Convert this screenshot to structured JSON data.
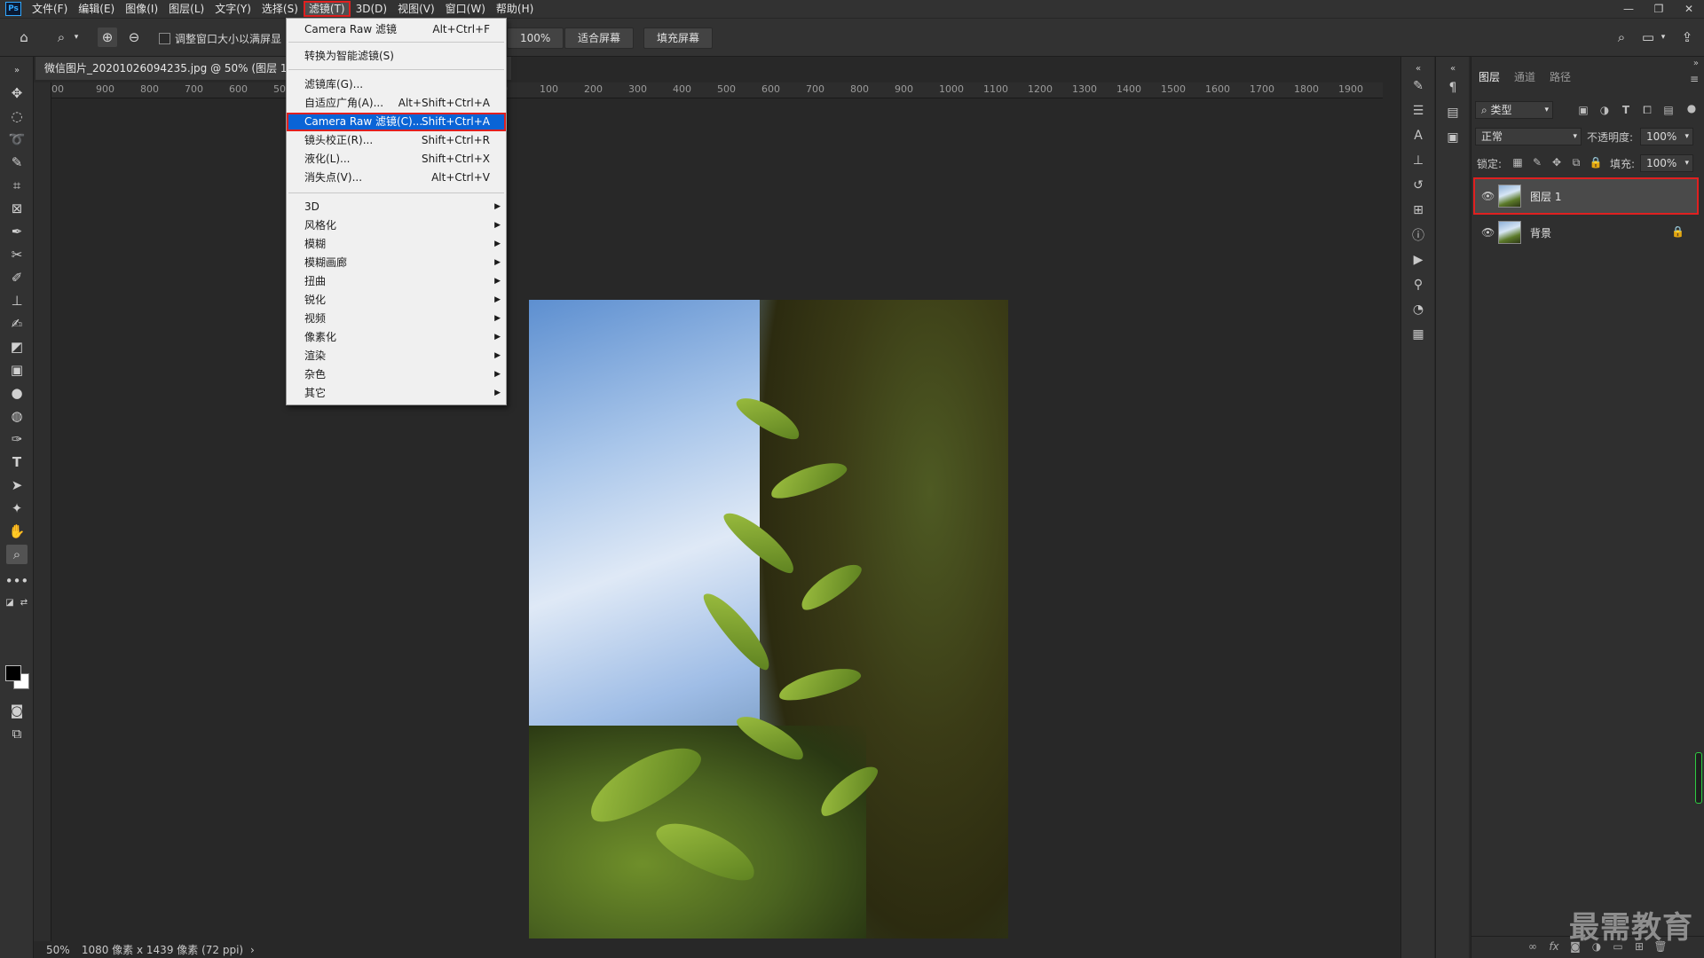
{
  "menubar": {
    "logo": "Ps",
    "items": [
      "文件(F)",
      "编辑(E)",
      "图像(I)",
      "图层(L)",
      "文字(Y)",
      "选择(S)",
      "滤镜(T)",
      "3D(D)",
      "视图(V)",
      "窗口(W)",
      "帮助(H)"
    ],
    "window_controls": [
      "—",
      "❐",
      "✕"
    ]
  },
  "options": {
    "resize_label": "调整窗口大小以满屏显",
    "zoom_btn": "100%",
    "fit_screen": "适合屏幕",
    "fill_screen": "填充屏幕"
  },
  "document": {
    "tab_title": "微信图片_20201026094235.jpg @ 50% (图层 1,",
    "ruler_ticks": [
      "00",
      "900",
      "800",
      "700",
      "600",
      "500",
      "",
      "",
      "",
      "",
      "00",
      "100",
      "200",
      "300",
      "400",
      "500",
      "600",
      "700",
      "800",
      "900",
      "1000",
      "1100",
      "1200",
      "1300",
      "1400",
      "1500",
      "1600",
      "1700",
      "1800",
      "1900",
      "200"
    ]
  },
  "filter_menu": {
    "last_filter": {
      "label": "Camera Raw 滤镜",
      "shortcut": "Alt+Ctrl+F"
    },
    "smart": {
      "label": "转换为智能滤镜(S)"
    },
    "group2": [
      {
        "label": "滤镜库(G)...",
        "shortcut": ""
      },
      {
        "label": "自适应广角(A)...",
        "shortcut": "Alt+Shift+Ctrl+A"
      },
      {
        "label": "Camera Raw 滤镜(C)...",
        "shortcut": "Shift+Ctrl+A"
      },
      {
        "label": "镜头校正(R)...",
        "shortcut": "Shift+Ctrl+R"
      },
      {
        "label": "液化(L)...",
        "shortcut": "Shift+Ctrl+X"
      },
      {
        "label": "消失点(V)...",
        "shortcut": "Alt+Ctrl+V"
      }
    ],
    "submenus": [
      "3D",
      "风格化",
      "模糊",
      "模糊画廊",
      "扭曲",
      "锐化",
      "视频",
      "像素化",
      "渲染",
      "杂色",
      "其它"
    ]
  },
  "layers_panel": {
    "tabs": [
      "图层",
      "通道",
      "路径"
    ],
    "filter_kind": "类型",
    "blend_mode": "正常",
    "opacity_label": "不透明度:",
    "opacity_value": "100%",
    "lock_label": "锁定:",
    "fill_label": "填充:",
    "fill_value": "100%",
    "layers": [
      {
        "name": "图层 1",
        "selected": true
      },
      {
        "name": "背景",
        "selected": false,
        "locked": true
      }
    ],
    "footer_icons": [
      "link-icon",
      "fx-icon",
      "mask-icon",
      "adjustment-icon",
      "group-icon",
      "new-layer-icon",
      "trash-icon"
    ]
  },
  "status": {
    "zoom": "50%",
    "info": "1080 像素 x 1439 像素 (72 ppi)"
  },
  "watermark": "最需教育",
  "colors": {
    "accent": "#0a64d6",
    "highlight_outline": "#e02020"
  }
}
